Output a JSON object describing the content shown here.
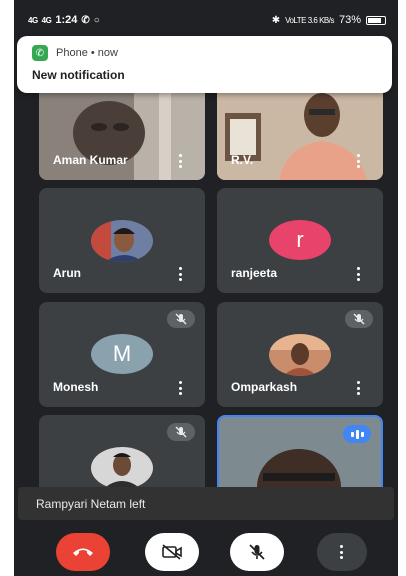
{
  "status_bar": {
    "signal1": "4G",
    "signal2": "4G",
    "time": "1:24",
    "right_small": "VoLTE 3.6 KB/s",
    "battery": "73%"
  },
  "notification": {
    "app": "Phone • now",
    "title": "New notification"
  },
  "tiles": [
    {
      "name": "Aman Kumar"
    },
    {
      "name": "R.V."
    },
    {
      "name": "Arun"
    },
    {
      "name": "ranjeeta",
      "initial": "r"
    },
    {
      "name": "Monesh",
      "initial": "M"
    },
    {
      "name": "Omparkash"
    },
    {
      "name": ""
    },
    {
      "name": ""
    }
  ],
  "toast": "Rampyari Netam left",
  "colors": {
    "background": "#202124",
    "tile": "#3c4043",
    "end_call": "#ea4335",
    "ranjeeta_avatar": "#e8436b",
    "monesh_avatar": "#8aa2ad",
    "active_speaker": "#4285f4"
  },
  "icons": {
    "end_call": "phone-hangup-icon",
    "camera": "camera-off-icon",
    "mic": "mic-off-icon",
    "more": "more-vert-icon"
  }
}
